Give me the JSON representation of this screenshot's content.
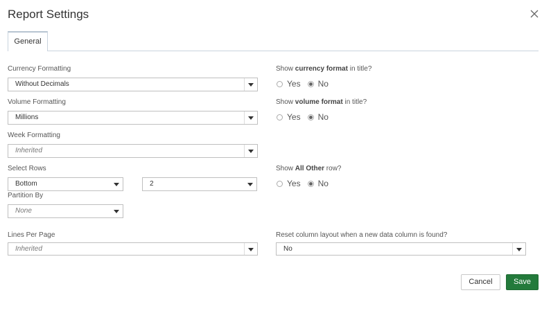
{
  "dialog": {
    "title": "Report Settings"
  },
  "tabs": [
    {
      "label": "General"
    }
  ],
  "currency": {
    "label": "Currency Formatting",
    "value": "Without Decimals",
    "title_question_prefix": "Show ",
    "title_question_bold": "currency format",
    "title_question_suffix": " in title?",
    "yes_label": "Yes",
    "no_label": "No",
    "selected": "No"
  },
  "volume": {
    "label": "Volume Formatting",
    "value": "Millions",
    "title_question_prefix": "Show ",
    "title_question_bold": "volume format",
    "title_question_suffix": " in title?",
    "yes_label": "Yes",
    "no_label": "No",
    "selected": "No"
  },
  "week": {
    "label": "Week Formatting",
    "value": "Inherited"
  },
  "select_rows": {
    "label": "Select Rows",
    "position_value": "Bottom",
    "count_value": "2",
    "all_other_prefix": "Show ",
    "all_other_bold": "All Other",
    "all_other_suffix": " row?",
    "yes_label": "Yes",
    "no_label": "No",
    "selected": "No"
  },
  "partition": {
    "label": "Partition By",
    "value": "None"
  },
  "lines_per_page": {
    "label": "Lines Per Page",
    "value": "Inherited"
  },
  "reset_layout": {
    "label": "Reset column layout when a new data column is found?",
    "value": "No"
  },
  "footer": {
    "cancel_label": "Cancel",
    "save_label": "Save"
  },
  "colors": {
    "save_button": "#237a3b",
    "border": "#bfbfbf"
  }
}
